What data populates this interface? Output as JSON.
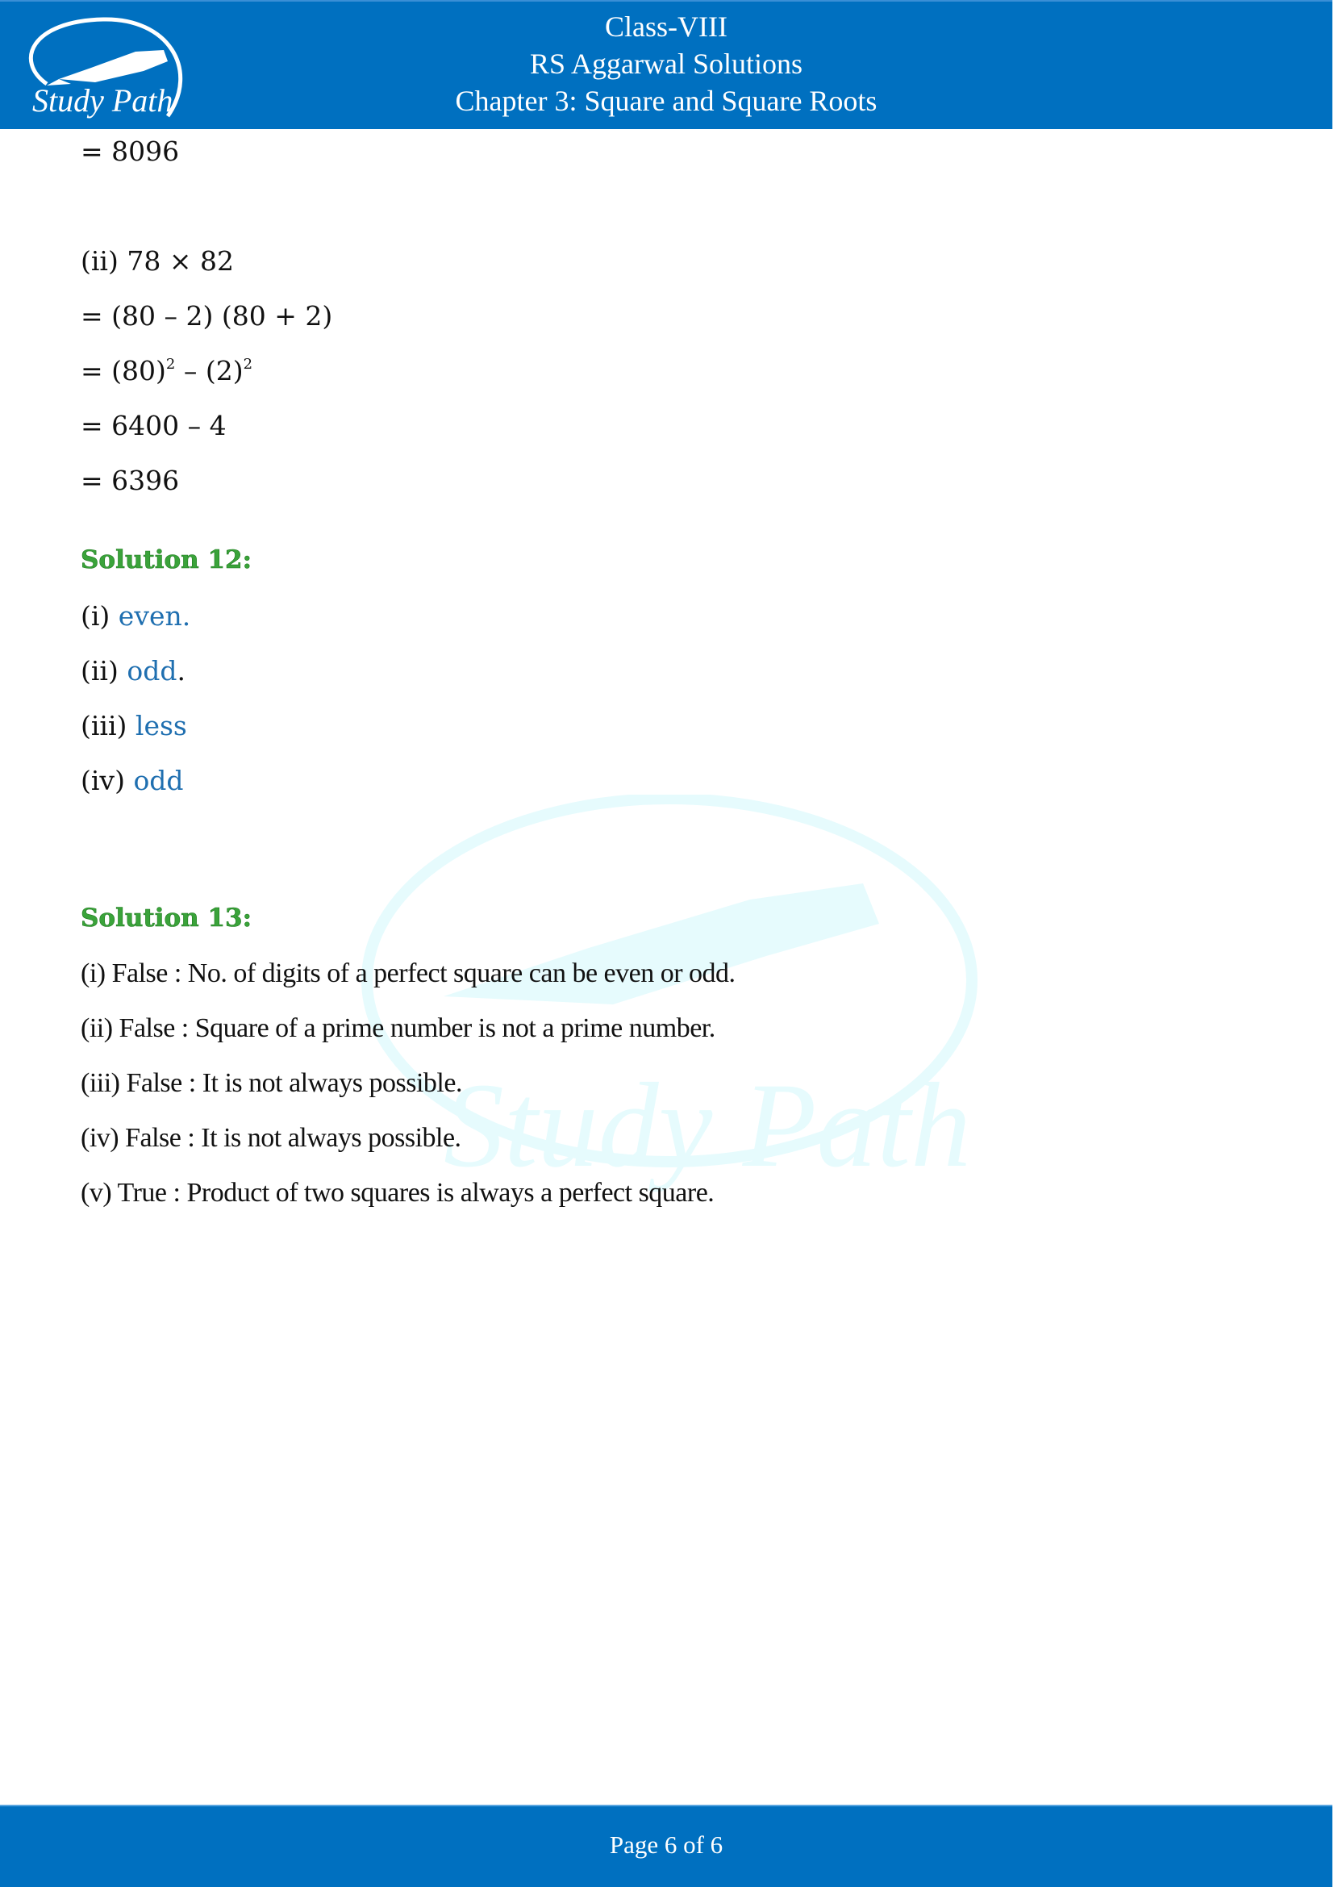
{
  "header": {
    "logo_text": "Study Path",
    "line1": "Class-VIII",
    "line2": "RS Aggarwal Solutions",
    "line3": "Chapter 3: Square and Square Roots"
  },
  "watermark_text": "Study Path",
  "continuation": {
    "result": "= 8096"
  },
  "part_ii": {
    "question": "(ii) 78 × 82",
    "step1": "= (80 – 2) (80 + 2)",
    "step2_a": "= (80)",
    "step2_exp1": "2",
    "step2_b": " – (2)",
    "step2_exp2": "2",
    "step3": "= 6400 – 4",
    "step4": "= 6396"
  },
  "solution12": {
    "title": "Solution 12:",
    "items": [
      {
        "label": "(i) ",
        "answer": "even.",
        "suffix": ""
      },
      {
        "label": "(ii) ",
        "answer": "odd",
        "suffix": "."
      },
      {
        "label": "(iii) ",
        "answer": "less",
        "suffix": ""
      },
      {
        "label": "(iv) ",
        "answer": "odd",
        "suffix": ""
      }
    ]
  },
  "solution13": {
    "title": "Solution 13:",
    "items": [
      "(i) False : No. of digits of a perfect square can be even or odd.",
      "(ii) False : Square of a prime number is not a prime number.",
      "(iii) False : It is not always possible.",
      "(iv) False : It is not always possible.",
      "(v) True : Product of two squares is always a perfect square."
    ]
  },
  "footer": {
    "page_label": "Page 6 of 6"
  },
  "colors": {
    "brand_blue": "#0070c0",
    "heading_green": "#3aa33a",
    "answer_blue": "#1f6fb0",
    "watermark": "#e6fbfd"
  }
}
